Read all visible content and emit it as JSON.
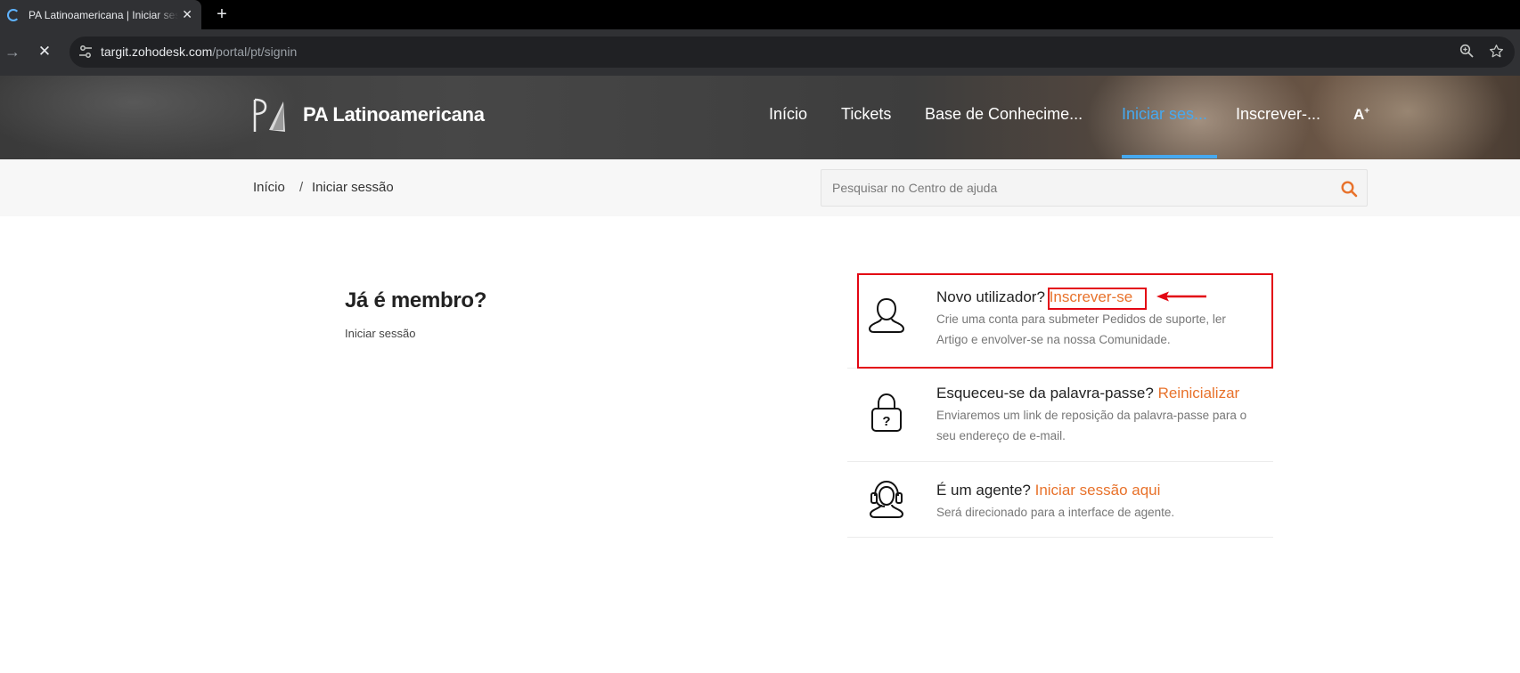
{
  "browser": {
    "tab_title": "PA Latinoamericana | Iniciar sessão",
    "close_glyph": "✕",
    "new_tab_glyph": "+",
    "url_host": "targit.zohodesk.com",
    "url_path": "/portal/pt/signin"
  },
  "site": {
    "brand_name": "PA Latinoamericana",
    "nav": {
      "home": "Início",
      "tickets": "Tickets",
      "knowledge_base": "Base de Conhecime...",
      "sign_in": "Iniciar ses...",
      "sign_up": "Inscrever-..."
    },
    "font_size_toggle": "A"
  },
  "breadcrumb": {
    "home": "Início",
    "separator": "/",
    "current": "Iniciar sessão"
  },
  "search": {
    "placeholder": "Pesquisar no Centro de ajuda"
  },
  "member": {
    "title": "Já é membro?",
    "sign_in_link": "Iniciar sessão"
  },
  "options": {
    "new_user": {
      "question": "Novo utilizador?",
      "action": "Inscrever-se",
      "description": "Crie uma conta para submeter Pedidos de suporte, ler Artigo e envolver-se na nossa Comunidade."
    },
    "forgot_password": {
      "question": "Esqueceu-se da palavra-passe?",
      "action": "Reinicializar",
      "description": "Enviaremos um link de reposição da palavra-passe para o seu endereço de e-mail."
    },
    "agent": {
      "question": "É um agente?",
      "action": "Iniciar sessão aqui",
      "description": "Será direcionado para a interface de agente."
    }
  },
  "icons": {
    "favicon": "zoho-favicon-icon",
    "site_info": "tune-icon",
    "zoom": "zoom-icon",
    "bookmark": "star-icon",
    "search": "search-icon",
    "user": "user-icon",
    "lock": "lock-question-icon",
    "agent": "headset-agent-icon"
  },
  "colors": {
    "accent_orange": "#e8722b",
    "active_nav_blue": "#46a9f0",
    "annotation_red": "#e30613"
  }
}
